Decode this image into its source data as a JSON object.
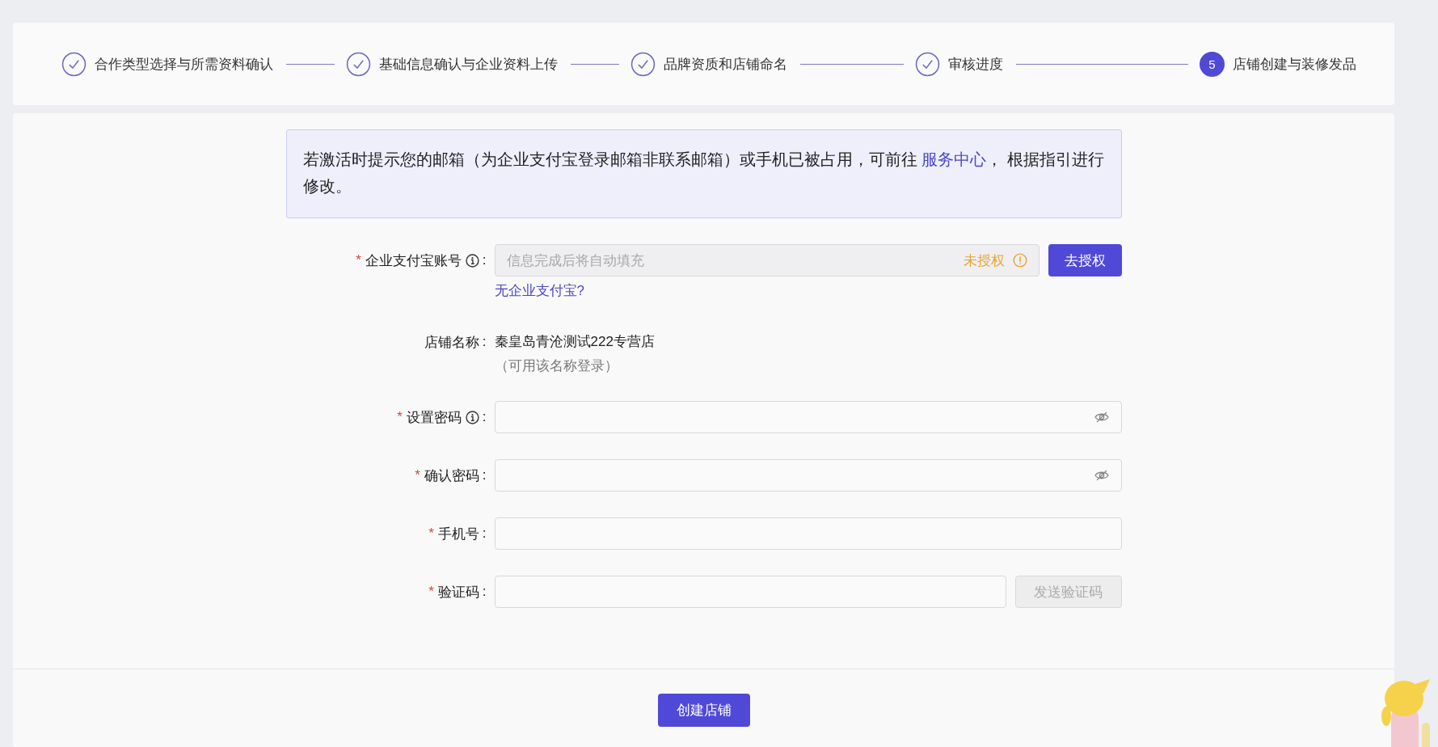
{
  "steps": [
    {
      "label": "合作类型选择与所需资料确认",
      "done": true
    },
    {
      "label": "基础信息确认与企业资料上传",
      "done": true
    },
    {
      "label": "品牌资质和店铺命名",
      "done": true
    },
    {
      "label": "审核进度",
      "done": true
    },
    {
      "label": "店铺创建与装修发品",
      "done": false,
      "number": "5"
    }
  ],
  "notice": {
    "before": "若激活时提示您的邮箱（为企业支付宝登录邮箱非联系邮箱）或手机已被占用，可前往 ",
    "link": "服务中心",
    "after": "， 根据指引进行修改。"
  },
  "form": [
    {
      "kind": "account",
      "mark": "*",
      "label": "企业支付宝账号",
      "info": true,
      "colon": ":",
      "placeholder": "信息完成后将自动填充",
      "status": "未授权",
      "button": "去授权",
      "link": "无企业支付宝?"
    },
    {
      "kind": "text",
      "label": "店铺名称",
      "colon": ":",
      "value": "秦皇岛青沧测试222专营店",
      "hint": "（可用该名称登录）"
    },
    {
      "kind": "password",
      "mark": "*",
      "label": "设置密码",
      "info": true,
      "colon": ":"
    },
    {
      "kind": "password",
      "mark": "*",
      "label": "确认密码",
      "colon": ":"
    },
    {
      "kind": "input",
      "mark": "*",
      "label": "手机号",
      "colon": ":"
    },
    {
      "kind": "code",
      "mark": "*",
      "label": "验证码",
      "colon": ":",
      "button": "发送验证码",
      "button_disabled": true
    }
  ],
  "submit": "创建店铺"
}
